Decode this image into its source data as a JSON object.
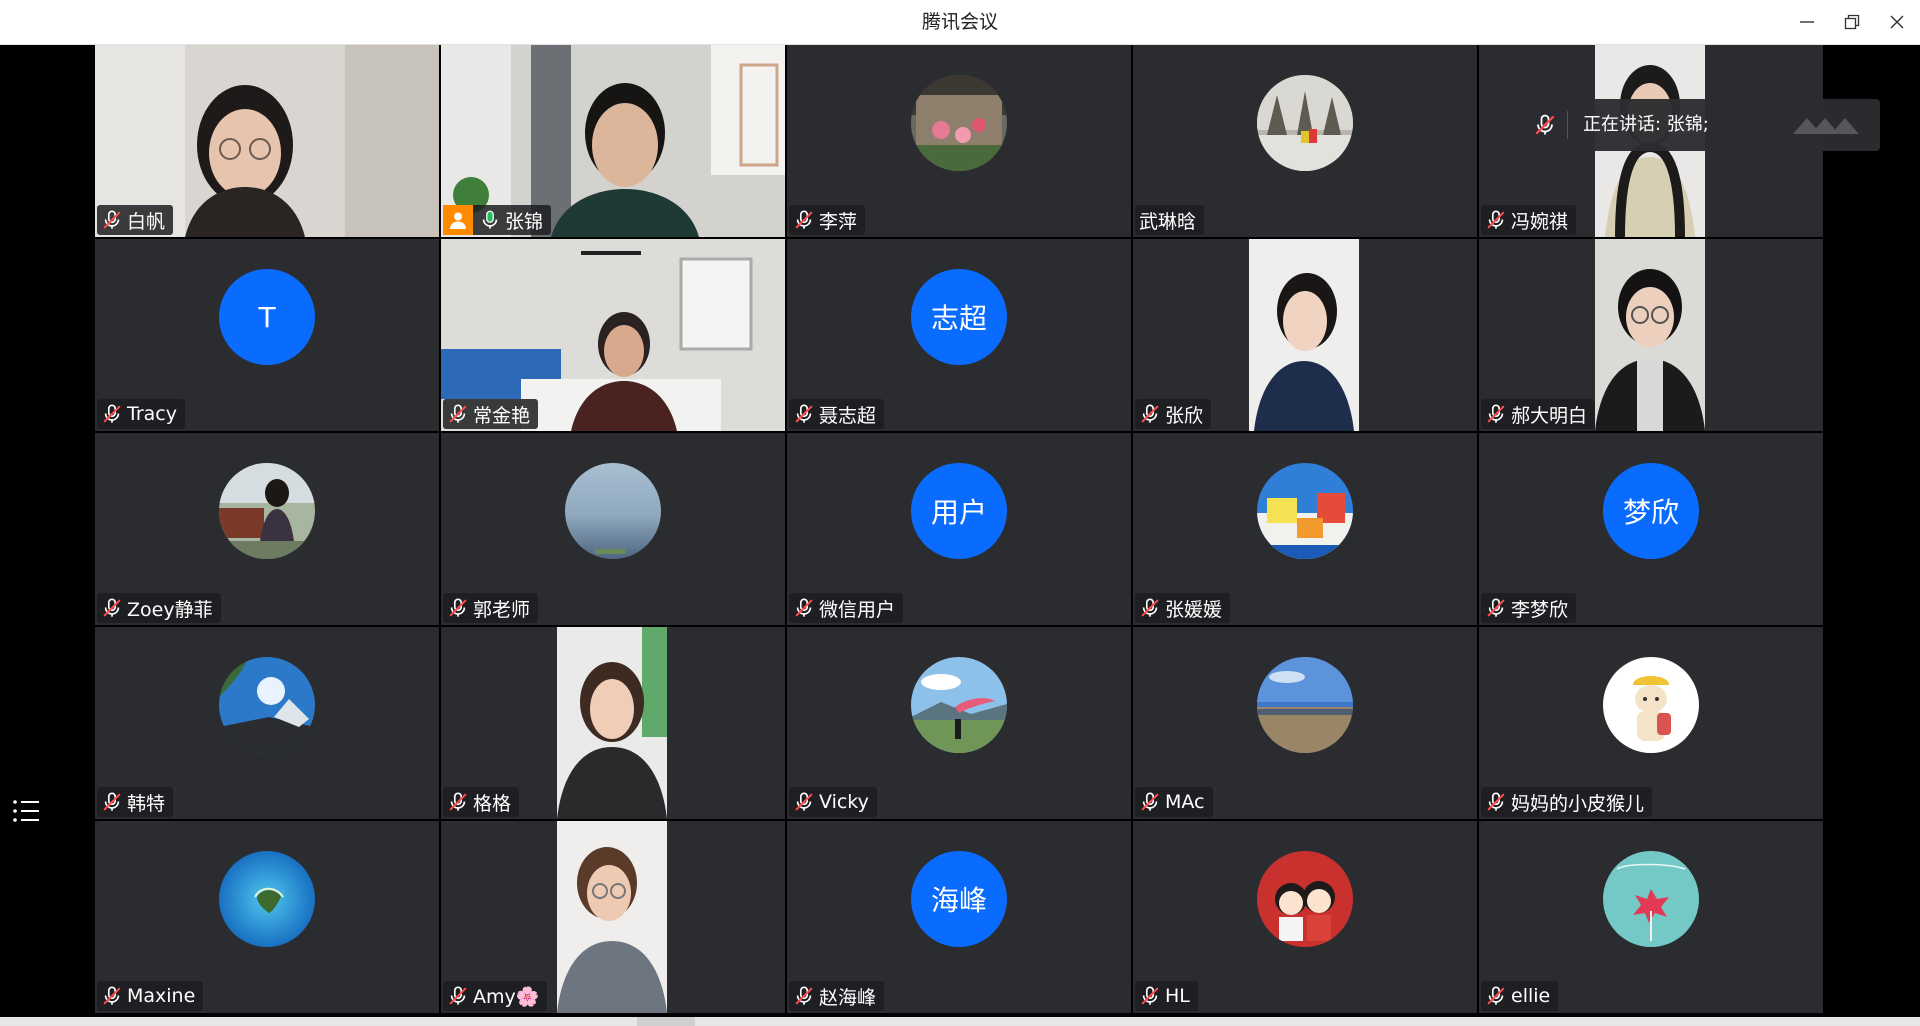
{
  "window": {
    "title": "腾讯会议",
    "controls": [
      "minimize-icon",
      "restore-icon",
      "close-icon"
    ]
  },
  "speaking_banner": {
    "text": "正在讲话: 张锦;"
  },
  "colors": {
    "accent_blue": "#0a6cff",
    "active_border": "#1aad5e",
    "tile_bg": "#2b2c2f",
    "host_badge": "#ff8a00"
  },
  "participants": [
    {
      "name": "白帆",
      "mic": "muted",
      "display": "video"
    },
    {
      "name": "张锦",
      "mic": "on",
      "display": "video",
      "host": true,
      "active": true
    },
    {
      "name": "李萍",
      "mic": "muted",
      "display": "avatar-image"
    },
    {
      "name": "武琳晗",
      "mic": "none",
      "display": "avatar-image"
    },
    {
      "name": "冯婉祺",
      "mic": "muted",
      "display": "video"
    },
    {
      "name": "Tracy",
      "mic": "muted",
      "display": "avatar-text",
      "avatar_text": "T"
    },
    {
      "name": "常金艳",
      "mic": "muted",
      "display": "video"
    },
    {
      "name": "聂志超",
      "mic": "muted",
      "display": "avatar-text",
      "avatar_text": "志超"
    },
    {
      "name": "张欣",
      "mic": "muted",
      "display": "video"
    },
    {
      "name": "郝大明白",
      "mic": "muted",
      "display": "video"
    },
    {
      "name": "Zoey静菲",
      "mic": "muted",
      "display": "avatar-image"
    },
    {
      "name": "郭老师",
      "mic": "muted",
      "display": "avatar-image"
    },
    {
      "name": "微信用户",
      "mic": "muted",
      "display": "avatar-text",
      "avatar_text": "用户"
    },
    {
      "name": "张媛媛",
      "mic": "muted",
      "display": "avatar-image"
    },
    {
      "name": "李梦欣",
      "mic": "muted",
      "display": "avatar-text",
      "avatar_text": "梦欣"
    },
    {
      "name": "韩特",
      "mic": "muted",
      "display": "avatar-image"
    },
    {
      "name": "格格",
      "mic": "muted",
      "display": "video"
    },
    {
      "name": "Vicky",
      "mic": "muted",
      "display": "avatar-image"
    },
    {
      "name": "MAc",
      "mic": "muted",
      "display": "avatar-image"
    },
    {
      "name": "妈妈的小皮猴儿",
      "mic": "muted",
      "display": "avatar-image"
    },
    {
      "name": "Maxine",
      "mic": "muted",
      "display": "avatar-image"
    },
    {
      "name": "Amy🌸",
      "mic": "muted",
      "display": "video"
    },
    {
      "name": "赵海峰",
      "mic": "muted",
      "display": "avatar-text",
      "avatar_text": "海峰"
    },
    {
      "name": "HL",
      "mic": "muted",
      "display": "avatar-image"
    },
    {
      "name": "ellie",
      "mic": "muted",
      "display": "avatar-image"
    }
  ]
}
